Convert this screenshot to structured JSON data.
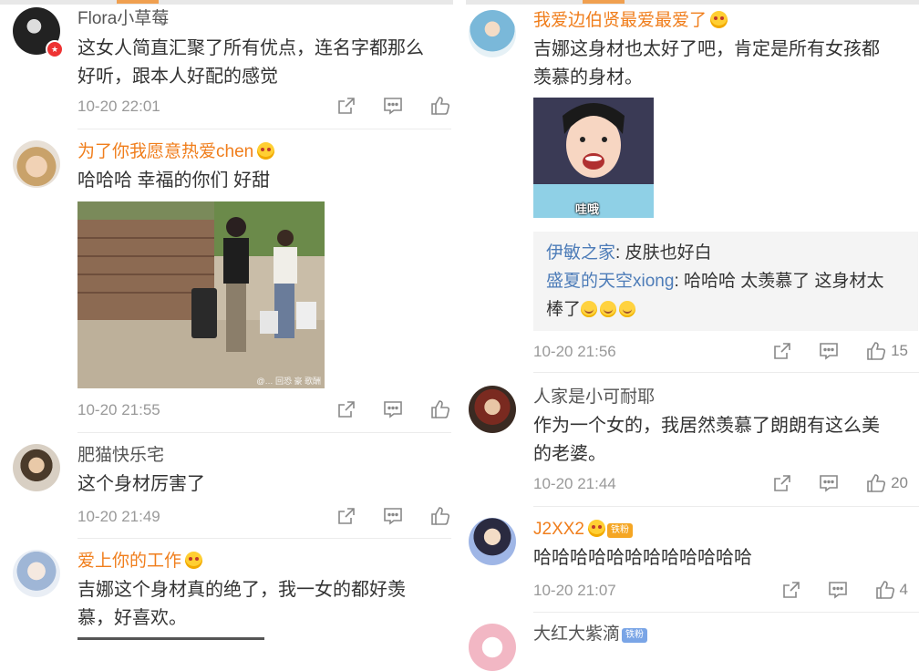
{
  "left": {
    "comments": [
      {
        "user": "Flora小草莓",
        "text_lines": [
          "这女人简直汇聚了所有优点，连名字都那么",
          "好听，跟本人好配的感觉"
        ],
        "time": "10-20 22:01",
        "likes": ""
      },
      {
        "user": "为了你我愿意热爱chen",
        "text_lines": [
          "哈哈哈 幸福的你们 好甜"
        ],
        "time": "10-20 21:55",
        "likes": "",
        "photo_watermark": "@… 回恐 豪 歌酬"
      },
      {
        "user": "肥猫快乐宅",
        "text_lines": [
          "这个身材厉害了"
        ],
        "time": "10-20 21:49",
        "likes": ""
      },
      {
        "user": "爱上你的工作",
        "text_lines": [
          "吉娜这个身材真的绝了，我一女的都好羡",
          "慕，好喜欢。"
        ],
        "time": "",
        "likes": ""
      }
    ]
  },
  "right": {
    "comments": [
      {
        "user": "我爱边伯贤最爱最爱了",
        "text_lines": [
          "吉娜这身材也太好了吧，肯定是所有女孩都",
          "羡慕的身材。"
        ],
        "sticker_caption": "哇哦",
        "replies": [
          {
            "user": "伊敏之家",
            "text": ": 皮肤也好白"
          },
          {
            "user": "盛夏的天空xiong",
            "text": ": 哈哈哈 太羡慕了 这身材太",
            "text2": "棒了"
          }
        ],
        "time": "10-20 21:56",
        "likes": "15"
      },
      {
        "user": "人家是小可耐耶",
        "text_lines": [
          "作为一个女的，我居然羡慕了朗朗有这么美",
          "的老婆。"
        ],
        "time": "10-20 21:44",
        "likes": "20"
      },
      {
        "user": "J2XX2",
        "badge": "铁粉",
        "text_lines": [
          "哈哈哈哈哈哈哈哈哈哈哈哈"
        ],
        "time": "10-20 21:07",
        "likes": "4"
      },
      {
        "user": "大红大紫滴",
        "badge": "铁粉",
        "text_lines": [],
        "time": "",
        "likes": ""
      }
    ]
  },
  "icons": {
    "share": "share-icon",
    "comment": "comment-icon",
    "like": "like-icon"
  },
  "colors": {
    "username_orange": "#f07e1c",
    "reply_user_blue": "#4d7cb8",
    "meta_gray": "#999999"
  }
}
